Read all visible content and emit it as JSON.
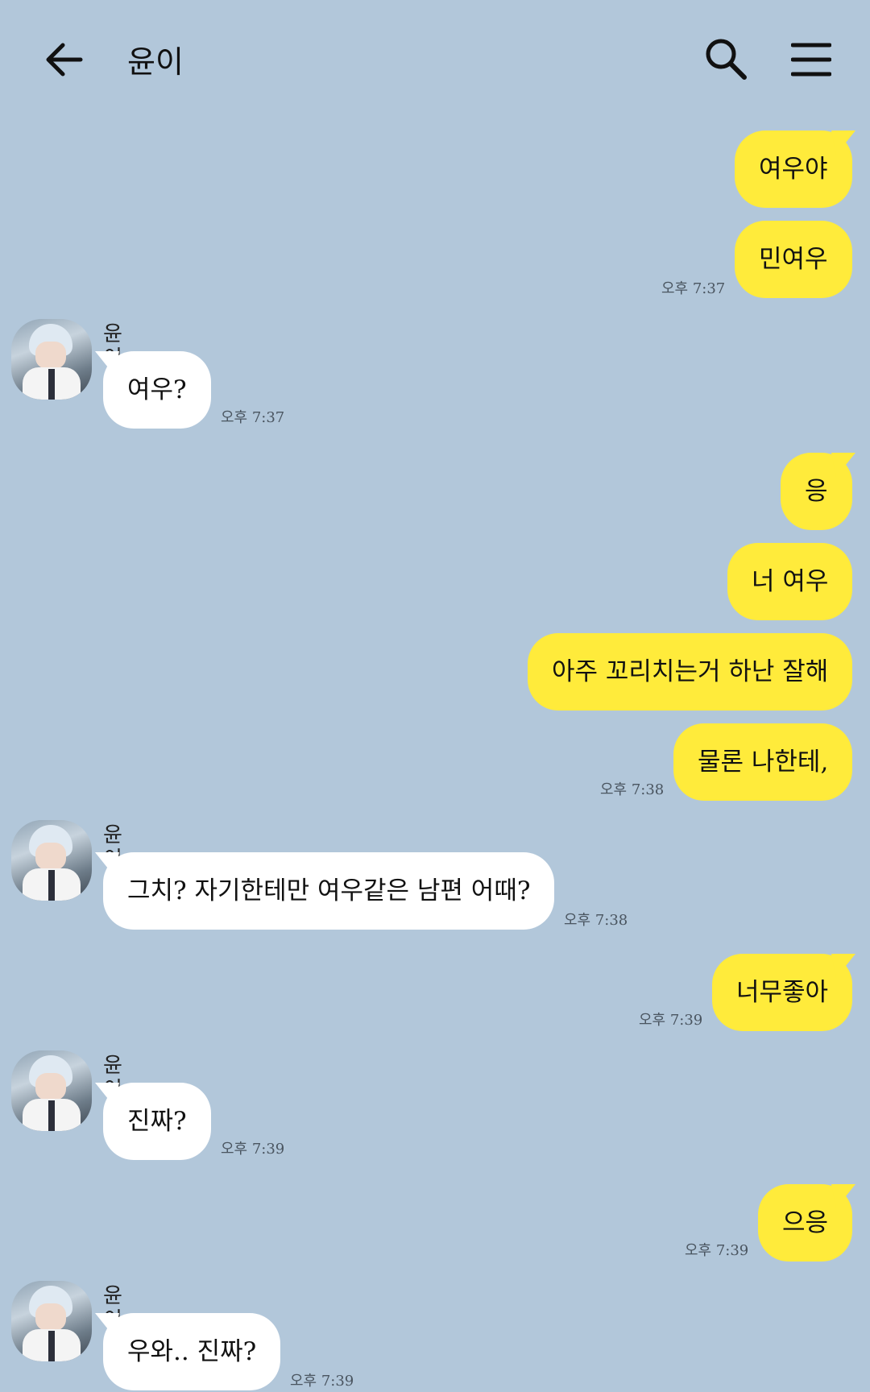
{
  "header": {
    "title": "윤이",
    "back_icon": "arrow-left-icon",
    "search_icon": "search-icon",
    "menu_icon": "hamburger-menu-icon"
  },
  "colors": {
    "background": "#b2c7da",
    "my_bubble": "#ffeb3b",
    "other_bubble": "#ffffff"
  },
  "messages": [
    {
      "from": "me",
      "text": "여우야"
    },
    {
      "from": "me",
      "text": "민여우",
      "time": "오후 7:37"
    },
    {
      "from": "other",
      "sender": "윤이",
      "text": "여우?",
      "time": "오후 7:37"
    },
    {
      "from": "me",
      "text": "응"
    },
    {
      "from": "me",
      "text": "너 여우"
    },
    {
      "from": "me",
      "text": "아주 꼬리치는거 하난 잘해"
    },
    {
      "from": "me",
      "text": "물론 나한테,",
      "time": "오후 7:38"
    },
    {
      "from": "other",
      "sender": "윤이",
      "text": "그치? 자기한테만 여우같은 남편 어때?",
      "time": "오후 7:38"
    },
    {
      "from": "me",
      "text": "너무좋아",
      "time": "오후 7:39"
    },
    {
      "from": "other",
      "sender": "윤이",
      "text": "진짜?",
      "time": "오후 7:39"
    },
    {
      "from": "me",
      "text": "으응",
      "time": "오후 7:39"
    },
    {
      "from": "other",
      "sender": "윤이",
      "text": "우와.. 진짜?",
      "time": "오후 7:39"
    }
  ]
}
